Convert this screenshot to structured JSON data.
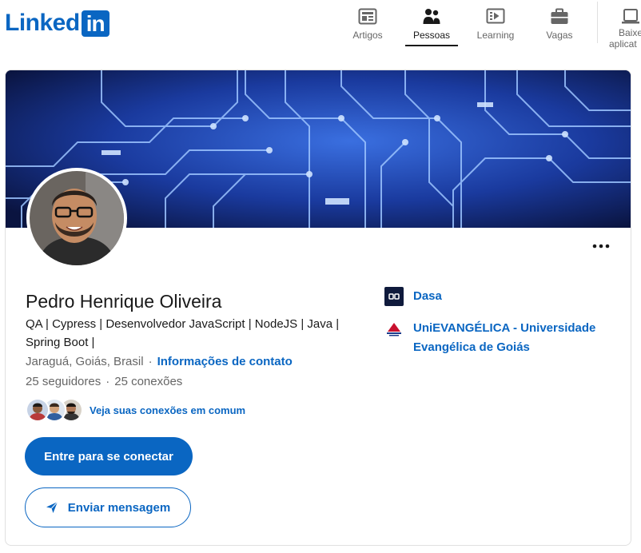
{
  "header": {
    "logo_word": "Linked",
    "logo_box": "in",
    "nav": [
      {
        "label": "Artigos",
        "icon": "articles-icon",
        "active": false
      },
      {
        "label": "Pessoas",
        "icon": "people-icon",
        "active": true
      },
      {
        "label": "Learning",
        "icon": "learning-icon",
        "active": false
      },
      {
        "label": "Vagas",
        "icon": "jobs-icon",
        "active": false
      }
    ],
    "app_label": "Baixe aplicat"
  },
  "profile": {
    "name": "Pedro Henrique Oliveira",
    "headline": "QA | Cypress | Desenvolvedor JavaScript | NodeJS | Java | Spring Boot |",
    "location": "Jaraguá, Goiás, Brasil",
    "contact_link": "Informações de contato",
    "followers": "25 seguidores",
    "connections": "25 conexões",
    "mutual_text": "Veja suas conexões em comum",
    "connect_button": "Entre para se conectar",
    "message_button": "Enviar mensagem"
  },
  "organizations": [
    {
      "name": "Dasa",
      "icon": "dasa-logo"
    },
    {
      "name": "UniEVANGÉLICA - Universidade Evangélica de Goiás",
      "icon": "university-logo"
    }
  ],
  "colors": {
    "brand": "#0a66c2",
    "text": "#191919",
    "muted": "#666666"
  }
}
